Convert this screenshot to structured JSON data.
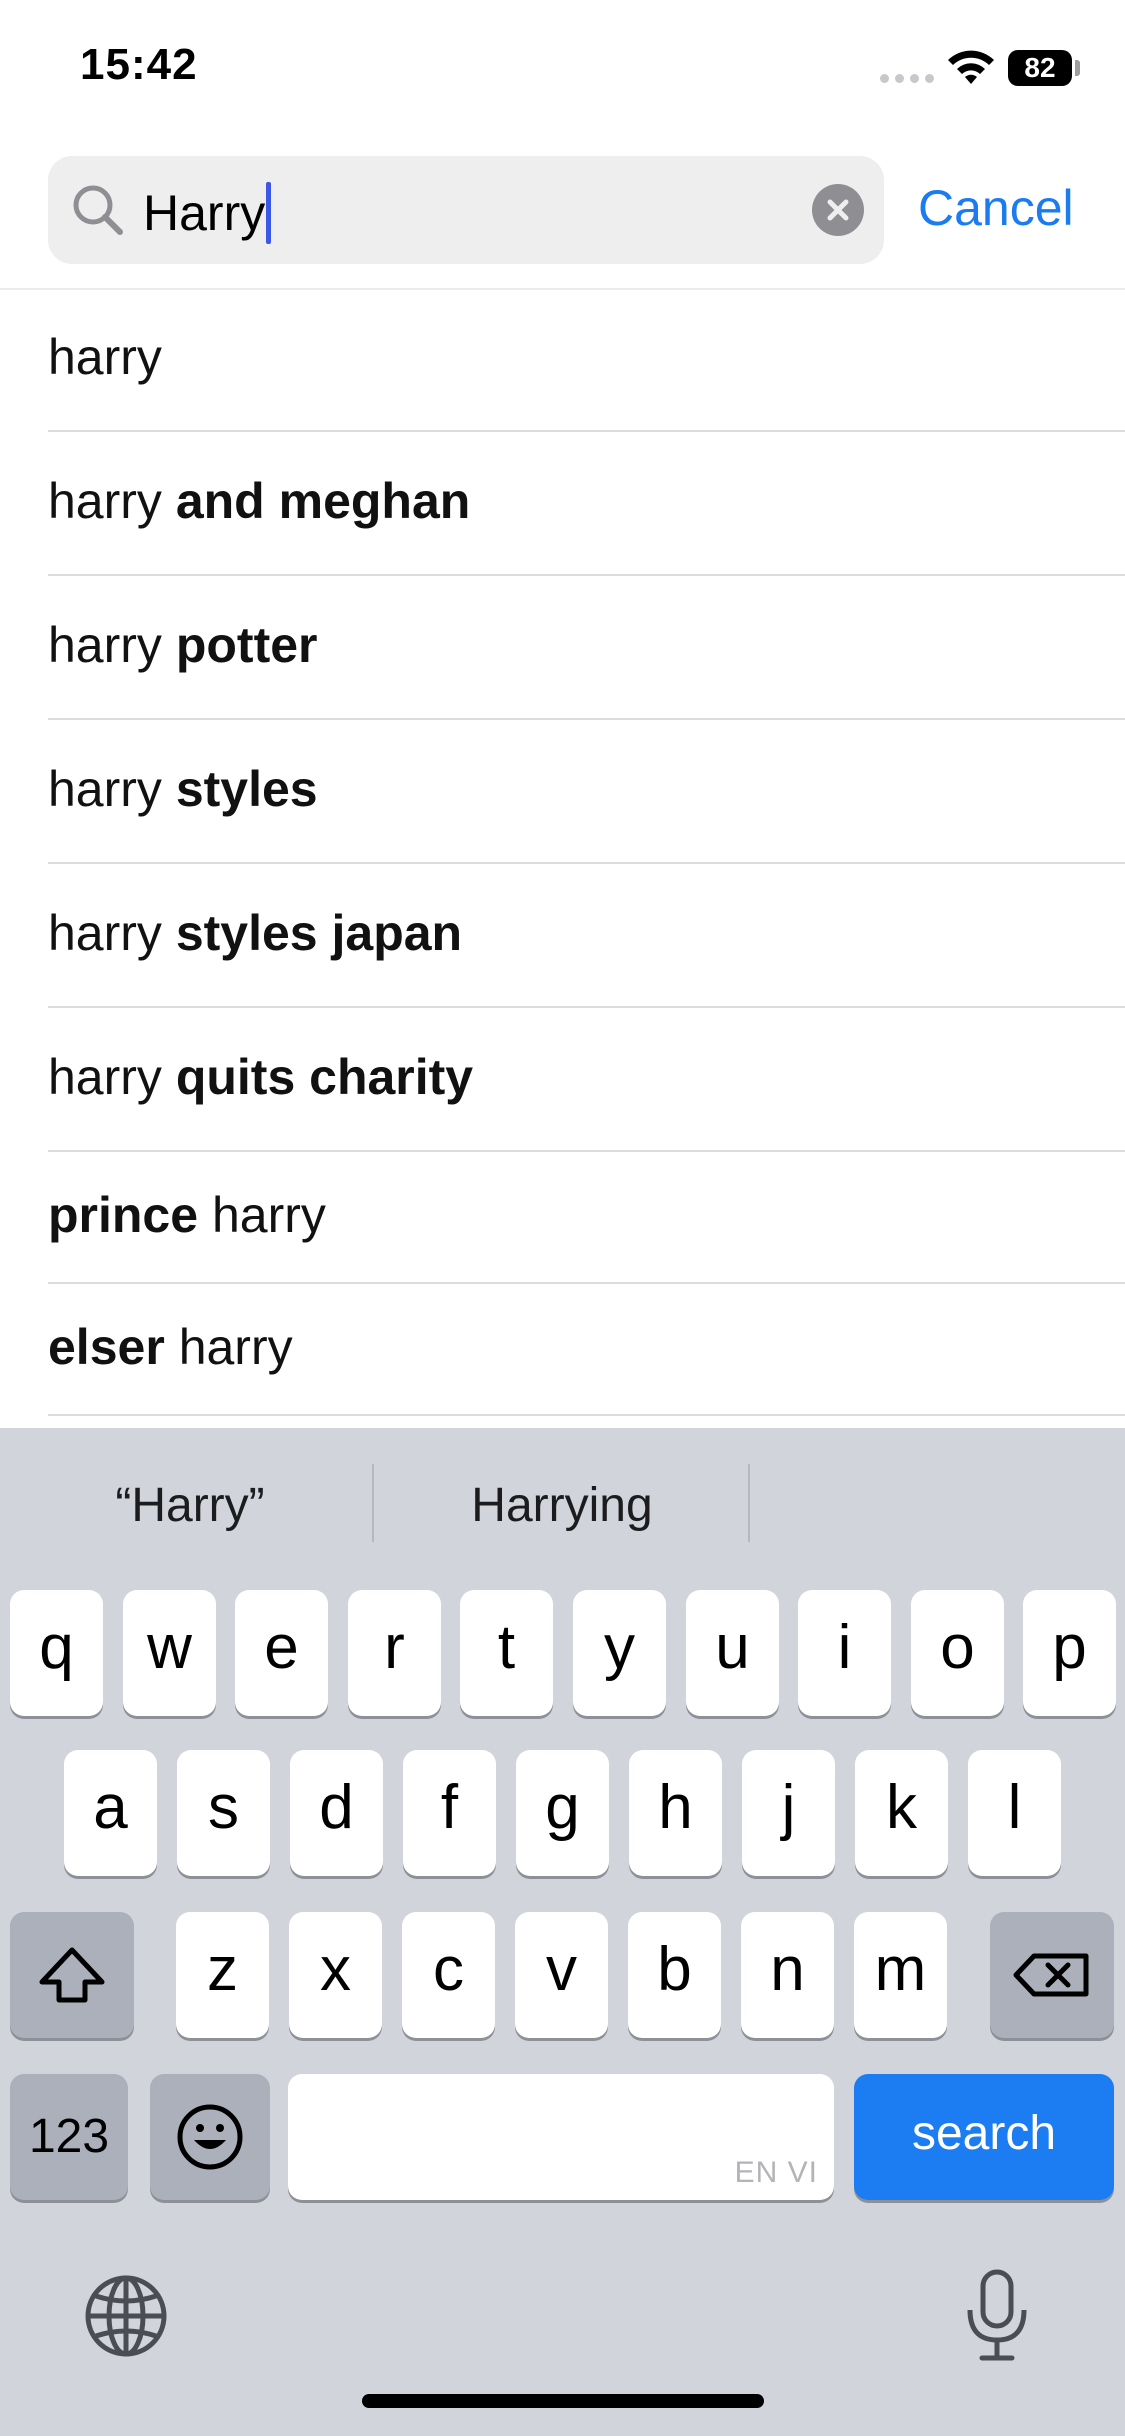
{
  "status_bar": {
    "time": "15:42",
    "battery": "82"
  },
  "search": {
    "query": "Harry",
    "cancel_label": "Cancel"
  },
  "suggestions": [
    {
      "prefix": "",
      "plain": "harry",
      "bold": ""
    },
    {
      "prefix": "",
      "plain": "harry",
      "bold": "and meghan"
    },
    {
      "prefix": "",
      "plain": "harry",
      "bold": "potter"
    },
    {
      "prefix": "",
      "plain": "harry",
      "bold": "styles"
    },
    {
      "prefix": "",
      "plain": "harry",
      "bold": "styles japan"
    },
    {
      "prefix": "",
      "plain": "harry",
      "bold": "quits charity"
    },
    {
      "prefix": "prince",
      "plain": "harry",
      "bold": ""
    },
    {
      "prefix": "elser",
      "plain": "harry",
      "bold": ""
    }
  ],
  "keyboard": {
    "predictions": [
      "“Harry”",
      "Harrying"
    ],
    "row1": [
      "q",
      "w",
      "e",
      "r",
      "t",
      "y",
      "u",
      "i",
      "o",
      "p"
    ],
    "row2": [
      "a",
      "s",
      "d",
      "f",
      "g",
      "h",
      "j",
      "k",
      "l"
    ],
    "row3": [
      "z",
      "x",
      "c",
      "v",
      "b",
      "n",
      "m"
    ],
    "numbers_label": "123",
    "space_languages": "EN VI",
    "search_label": "search"
  }
}
